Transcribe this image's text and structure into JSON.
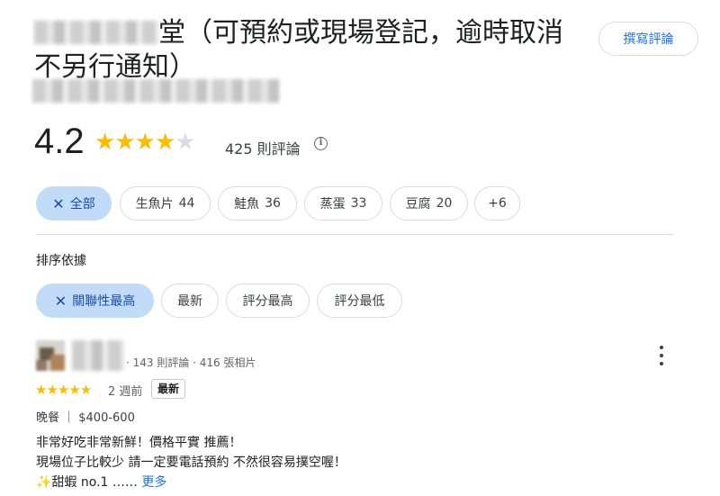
{
  "header": {
    "title_visible": "堂（可預約或現場登記，逾時取消不另行通知）",
    "write_review_label": "撰寫評論"
  },
  "rating": {
    "score": "4.2",
    "stars_filled": 4,
    "stars_total": 5,
    "review_count": "425 則評論",
    "info_icon": "info-icon"
  },
  "topic_chips": [
    {
      "label": "全部",
      "active": true,
      "icon": "close-icon"
    },
    {
      "label": "生魚片",
      "count": "44"
    },
    {
      "label": "鮭魚",
      "count": "36"
    },
    {
      "label": "蒸蛋",
      "count": "33"
    },
    {
      "label": "豆腐",
      "count": "20"
    },
    {
      "label": "+6"
    }
  ],
  "sort": {
    "label": "排序依據",
    "options": [
      {
        "label": "關聯性最高",
        "active": true,
        "icon": "close-icon"
      },
      {
        "label": "最新"
      },
      {
        "label": "評分最高"
      },
      {
        "label": "評分最低"
      }
    ]
  },
  "review": {
    "reviewer_meta": "· 143 則評論 · 416 張相片",
    "stars": 5,
    "time_ago": "2 週前",
    "badge": "最新",
    "meal_info": "晚餐 ｜ $400-600",
    "lines": [
      "非常好吃非常新鮮！價格平實 推薦！",
      "現場位子比較少 請一定要電話預約 不然很容易撲空喔！"
    ],
    "line3_emoji": "sparkle-icon",
    "line3_text": "甜蝦 no.1 ……",
    "more_label": "更多"
  },
  "colors": {
    "star": "#fbbc04",
    "active_chip": "#c2dbf9",
    "link": "#1a73e8"
  }
}
